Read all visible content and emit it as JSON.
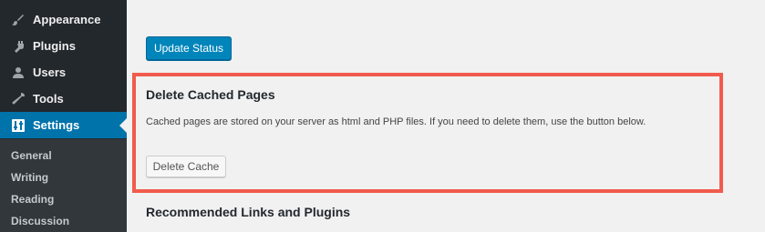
{
  "sidebar": {
    "items": [
      {
        "label": "Appearance",
        "icon": "paintbrush-icon"
      },
      {
        "label": "Plugins",
        "icon": "plug-icon"
      },
      {
        "label": "Users",
        "icon": "user-icon"
      },
      {
        "label": "Tools",
        "icon": "wrench-icon"
      },
      {
        "label": "Settings",
        "icon": "settings-icon",
        "active": true
      }
    ],
    "submenu": [
      "General",
      "Writing",
      "Reading",
      "Discussion"
    ]
  },
  "main": {
    "update_button": "Update Status",
    "section": {
      "title": "Delete Cached Pages",
      "description": "Cached pages are stored on your server as html and PHP files. If you need to delete them, use the button below.",
      "delete_button": "Delete Cache"
    },
    "next_section_title": "Recommended Links and Plugins"
  },
  "colors": {
    "sidebar_bg": "#23282d",
    "submenu_bg": "#32373c",
    "active_blue": "#0073aa",
    "primary_button": "#0085ba",
    "highlight_border": "#f15b4d",
    "page_bg": "#f1f1f1"
  }
}
